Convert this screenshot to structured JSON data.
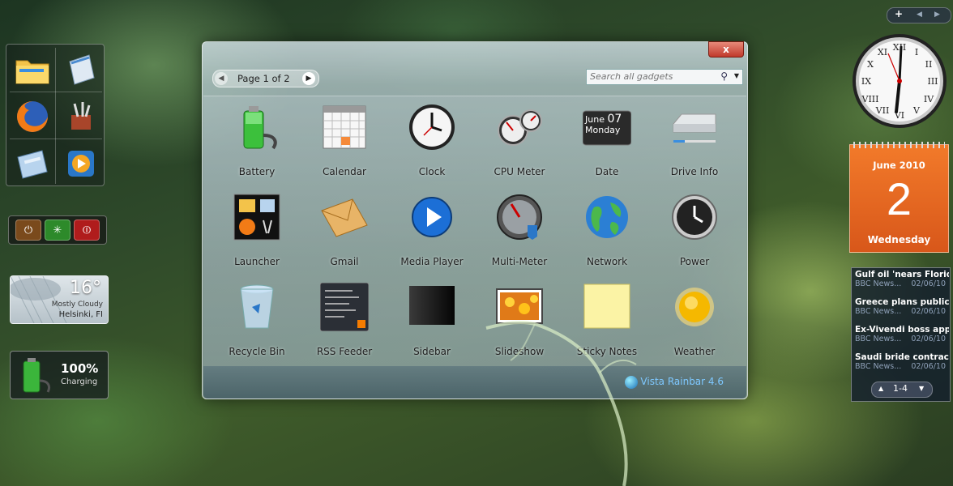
{
  "gallery": {
    "close_label": "x",
    "pager_label": "Page 1 of 2",
    "search_placeholder": "Search all gadgets",
    "footer_link": "Vista Rainbar 4.6",
    "gadgets": [
      {
        "label": "Battery",
        "icon": "battery-icon"
      },
      {
        "label": "Calendar",
        "icon": "calendar-icon"
      },
      {
        "label": "Clock",
        "icon": "clock-icon"
      },
      {
        "label": "CPU Meter",
        "icon": "cpu-meter-icon"
      },
      {
        "label": "Date",
        "icon": "date-icon",
        "month": "June",
        "day": "07",
        "weekday": "Monday"
      },
      {
        "label": "Drive Info",
        "icon": "drive-icon"
      },
      {
        "label": "Launcher",
        "icon": "launcher-icon"
      },
      {
        "label": "Gmail",
        "icon": "envelope-icon"
      },
      {
        "label": "Media Player",
        "icon": "play-icon"
      },
      {
        "label": "Multi-Meter",
        "icon": "gauge-icon"
      },
      {
        "label": "Network",
        "icon": "globe-icon"
      },
      {
        "label": "Power",
        "icon": "power-clock-icon"
      },
      {
        "label": "Recycle Bin",
        "icon": "recycle-bin-icon"
      },
      {
        "label": "RSS Feeder",
        "icon": "rss-icon"
      },
      {
        "label": "Sidebar",
        "icon": "sidebar-icon"
      },
      {
        "label": "Slideshow",
        "icon": "slideshow-icon"
      },
      {
        "label": "Sticky Notes",
        "icon": "sticky-note-icon"
      },
      {
        "label": "Weather",
        "icon": "sun-icon"
      }
    ]
  },
  "weather_small": {
    "temp": "16°",
    "condition": "Mostly Cloudy",
    "city": "Helsinki, FI"
  },
  "battery_small": {
    "percent": "100%",
    "status": "Charging"
  },
  "topbar": {
    "add": "+",
    "prev": "◀",
    "next": "▶"
  },
  "calendar_gadget": {
    "month_year": "June 2010",
    "day": "2",
    "weekday": "Wednesday"
  },
  "news": {
    "items": [
      {
        "headline": "Gulf oil 'nears Florid...",
        "source": "BBC News...",
        "date": "02/06/10"
      },
      {
        "headline": "Greece plans public...",
        "source": "BBC News...",
        "date": "02/06/10"
      },
      {
        "headline": "Ex-Vivendi boss app...",
        "source": "BBC News...",
        "date": "02/06/10"
      },
      {
        "headline": "Saudi bride contract...",
        "source": "BBC News...",
        "date": "02/06/10"
      }
    ],
    "range": "1-4"
  },
  "colors": {
    "calendar_orange": "#e8651f",
    "close_red": "#c0392b",
    "link_blue": "#7ec8ff"
  }
}
